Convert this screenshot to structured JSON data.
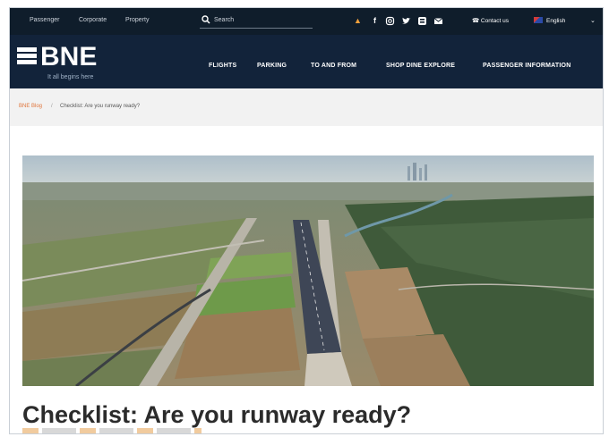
{
  "utility": {
    "links": [
      "Passenger",
      "Corporate",
      "Property"
    ],
    "search_placeholder": "Search",
    "contact_label": "Contact us",
    "language_label": "English"
  },
  "brand": {
    "name": "BNE",
    "tagline": "It all begins here"
  },
  "nav": {
    "items": [
      "FLIGHTS",
      "PARKING",
      "TO AND FROM",
      "SHOP DINE EXPLORE",
      "PASSENGER INFORMATION"
    ]
  },
  "breadcrumb": {
    "home": "BNE Blog",
    "separator": "/",
    "current": "Checklist: Are you runway ready?"
  },
  "article": {
    "title": "Checklist: Are you runway ready?"
  },
  "colors": {
    "utility_bg": "#0f1d2b",
    "header_bg": "#12233a",
    "accent": "#e0743a"
  },
  "icons": [
    "search-icon",
    "notification-icon",
    "facebook-icon",
    "instagram-icon",
    "twitter-icon",
    "blog-icon",
    "mail-icon",
    "phone-icon",
    "flag-icon",
    "chevron-down-icon"
  ]
}
